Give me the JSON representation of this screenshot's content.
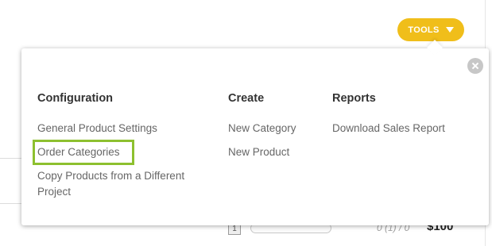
{
  "header": {
    "tools_label": "TOOLS"
  },
  "background": {
    "quantity": "1",
    "stock": "0 (1) / 0",
    "price": "$100"
  },
  "tools_menu": {
    "columns": [
      {
        "heading": "Configuration",
        "items": [
          "General Product Settings",
          "Order Categories",
          "Copy Products from a Different Project"
        ]
      },
      {
        "heading": "Create",
        "items": [
          "New Category",
          "New Product"
        ]
      },
      {
        "heading": "Reports",
        "items": [
          "Download Sales Report"
        ]
      }
    ]
  },
  "colors": {
    "accent": "#f0be1a",
    "highlight": "#8dc02f"
  }
}
